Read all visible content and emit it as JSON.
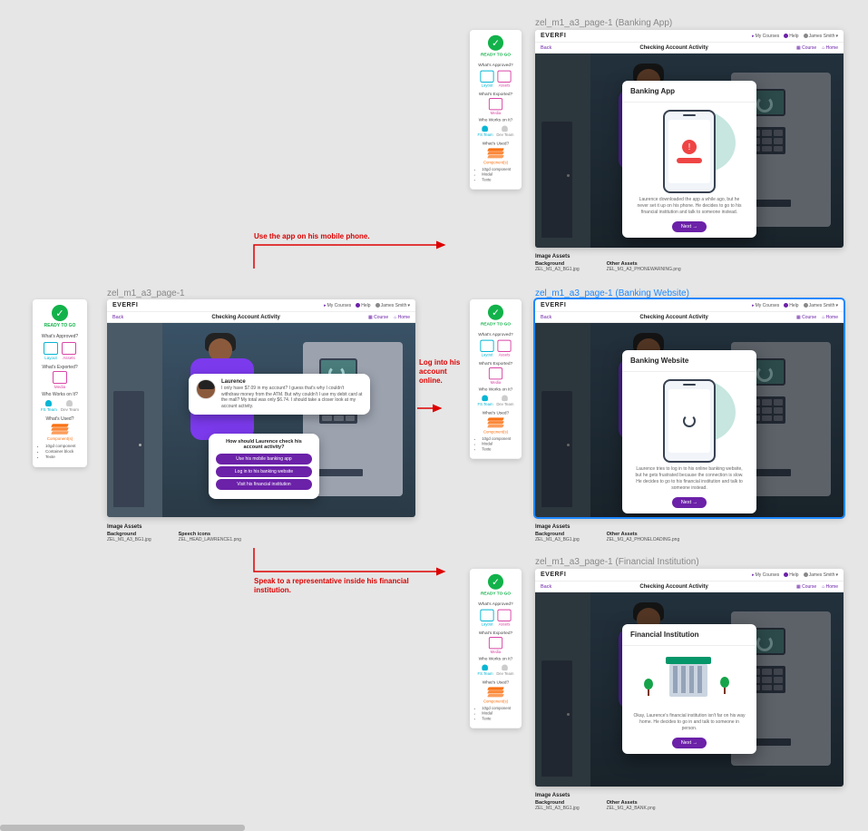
{
  "arrows": {
    "a1": "Use the app on his mobile phone.",
    "a2": "Log into his account online.",
    "a3": "Speak to a representative inside his financial institution."
  },
  "statusPanel": {
    "ready": "READY TO GO",
    "sections": {
      "approved": "What's Approved?",
      "exported": "What's Exported?",
      "works": "Who Works on It?",
      "used": "What's Used?"
    },
    "labels": {
      "layout": "Layout",
      "assets": "Assets",
      "media": "Media",
      "fsteam": "FS Team",
      "devteam": "Dev Team",
      "components": "Component(s)"
    },
    "usedList": [
      "10gd component",
      "Container block",
      "Texte"
    ],
    "usedListShort": [
      "10gd component",
      "Modal",
      "Texte"
    ]
  },
  "slideMain": {
    "title": "zel_m1_a3_page-1",
    "brand": "EVERFI",
    "headerLinks": {
      "courses": "My Courses",
      "help": "Help",
      "user": "James Smith"
    },
    "back": "Back",
    "lessonTitle": "Checking Account Activity",
    "course": "Course",
    "home": "Home",
    "character": {
      "name": "Laurence",
      "text": "I only have $7.09 in my account? I guess that's why I couldn't withdraw money from the ATM. But why couldn't I use my debit card at the mall? My total was only $6.74. I should take a closer look at my account activity."
    },
    "prompt": {
      "q": "How should Laurence check his account activity?",
      "o1": "Use his mobile banking app",
      "o2": "Log in to his banking website",
      "o3": "Visit his financial institution"
    },
    "assets": {
      "heading": "Image Assets",
      "col1h": "Background",
      "col1v": "ZEL_M1_A3_BG1.jpg",
      "col2h": "Speech icons",
      "col2v": "ZEL_HEAD_LAWRENCE1.png"
    }
  },
  "slideApp": {
    "title": "zel_m1_a3_page-1 (Banking App)",
    "modalTitle": "Banking App",
    "desc": "Laurence downloaded the app a while ago, but he never set it up on his phone. He decides to go to his financial institution and talk to someone instead.",
    "next": "Next →",
    "assets": {
      "heading": "Image Assets",
      "col1h": "Background",
      "col1v": "ZEL_M1_A3_BG1.jpg",
      "col2h": "Other Assets",
      "col2v": "ZEL_M1_A3_PHONEWARNING.png"
    }
  },
  "slideWeb": {
    "title": "zel_m1_a3_page-1 (Banking Website)",
    "modalTitle": "Banking Website",
    "desc": "Laurence tries to log in to his online banking website, but he gets frustrated because the connection is slow. He decides to go to his financial institution and talk to someone instead.",
    "next": "Next →",
    "assets": {
      "heading": "Image Assets",
      "col1h": "Background",
      "col1v": "ZEL_M1_A3_BG1.jpg",
      "col2h": "Other Assets",
      "col2v": "ZEL_M1_A3_PHONELOADING.png"
    }
  },
  "slideFin": {
    "title": "zel_m1_a3_page-1 (Financial Institution)",
    "modalTitle": "Financial Institution",
    "desc": "Okay, Laurence's financial institution isn't far on his way home. He decides to go in and talk to someone in person.",
    "next": "Next →",
    "assets": {
      "heading": "Image Assets",
      "col1h": "Background",
      "col1v": "ZEL_M1_A3_BG1.jpg",
      "col2h": "Other Assets",
      "col2v": "ZEL_M1_A3_BANK.png"
    }
  }
}
